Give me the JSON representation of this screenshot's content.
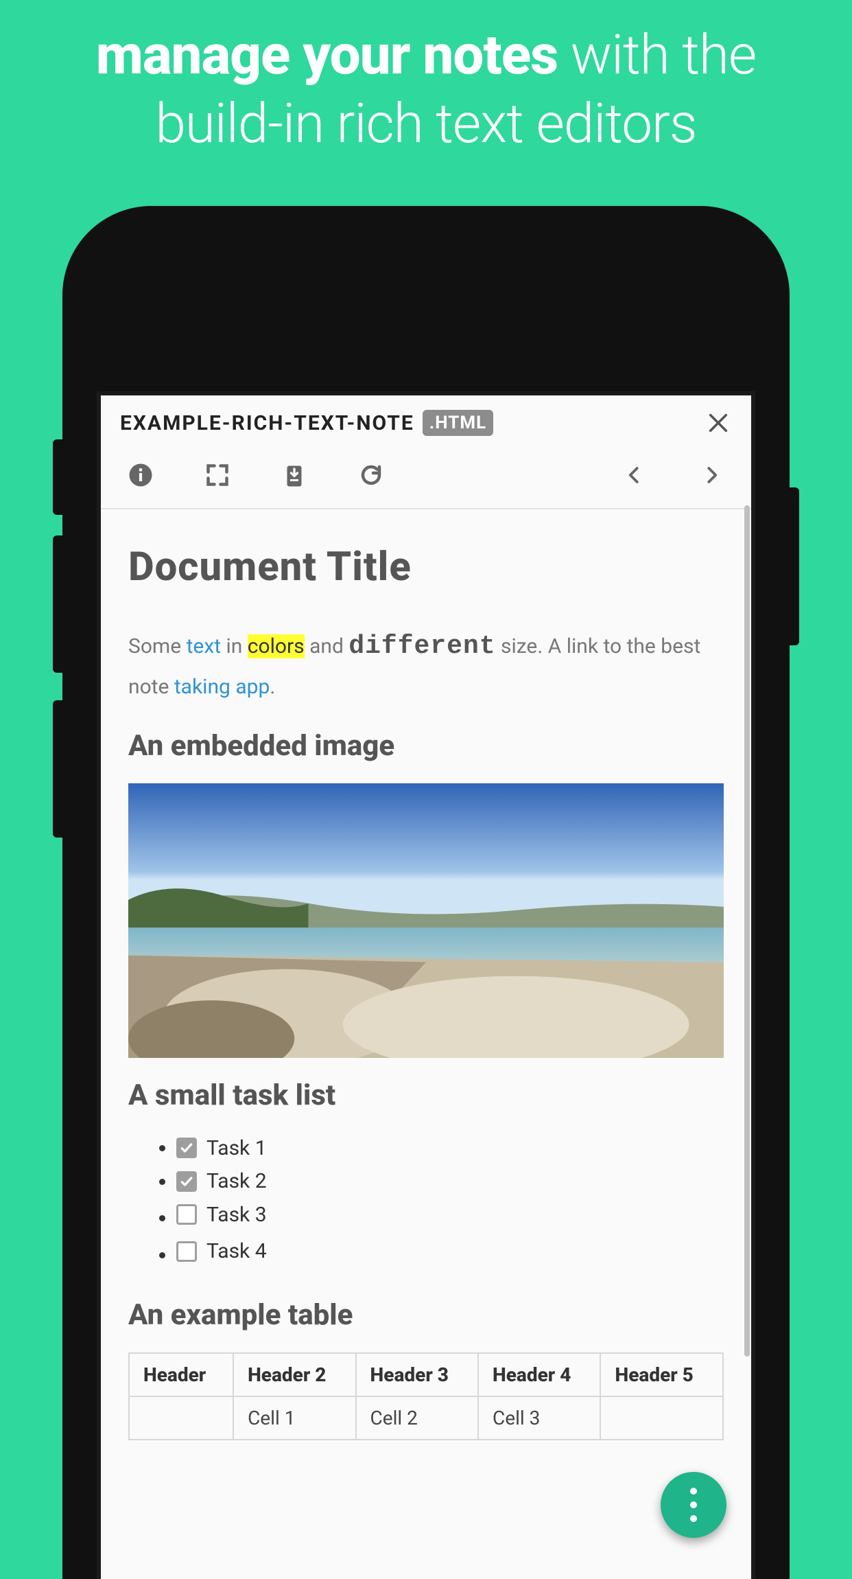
{
  "promo": {
    "bold": "manage your notes",
    "rest": " with the build-in rich text editors"
  },
  "file": {
    "name": "EXAMPLE-RICH-TEXT-NOTE",
    "ext": ".HTML"
  },
  "doc": {
    "title": "Document Title",
    "para": {
      "t1": "Some ",
      "t2": "text",
      "t3": " in ",
      "t4": "colors",
      "t5": " and ",
      "t6": "different",
      "t7": " size. A link to the best note ",
      "t8": "taking app",
      "t9": "."
    },
    "h_image": "An embedded image",
    "h_tasks": "A small task list",
    "tasks": [
      {
        "label": "Task 1",
        "checked": true
      },
      {
        "label": "Task 2",
        "checked": true
      },
      {
        "label": "Task 3",
        "checked": false
      },
      {
        "label": "Task 4",
        "checked": false
      }
    ],
    "h_table": "An example table",
    "table": {
      "headers": [
        "Header",
        "Header 2",
        "Header 3",
        "Header 4",
        "Header 5"
      ],
      "rows": [
        [
          "",
          "Cell 1",
          "Cell 2",
          "Cell 3",
          ""
        ]
      ]
    }
  },
  "icons": {
    "info": "info-icon",
    "fullscreen": "fullscreen-icon",
    "download": "download-icon",
    "refresh": "refresh-icon",
    "prev": "chevron-left-icon",
    "next": "chevron-right-icon",
    "close": "close-icon",
    "fab": "more-vert-icon"
  }
}
